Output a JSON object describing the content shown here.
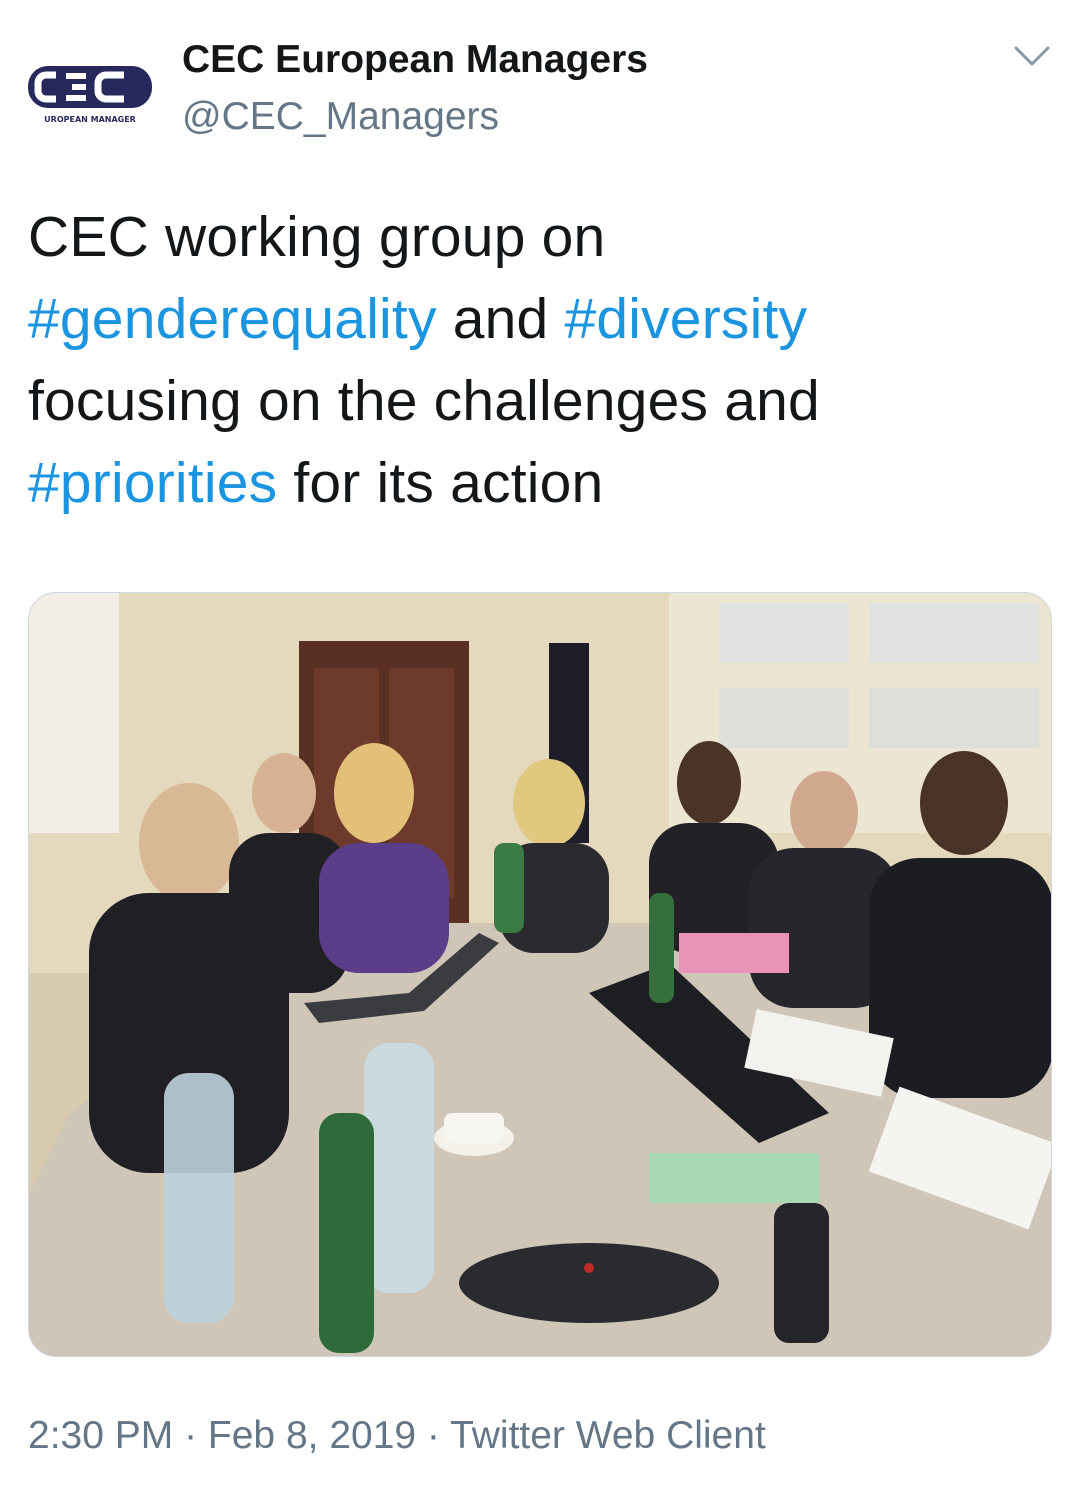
{
  "account": {
    "display_name": "CEC European Managers",
    "handle": "@CEC_Managers",
    "avatar_logo_text": "CEC",
    "avatar_logo_subtext": "UROPEAN MANAGER"
  },
  "tweet": {
    "lines": [
      [
        {
          "text": "CEC working group on",
          "type": "text"
        }
      ],
      [
        {
          "text": "#genderequality",
          "type": "hashtag"
        },
        {
          "text": " and ",
          "type": "text"
        },
        {
          "text": "#diversity",
          "type": "hashtag"
        }
      ],
      [
        {
          "text": "focusing on the challenges and",
          "type": "text"
        }
      ],
      [
        {
          "text": "#priorities",
          "type": "hashtag"
        },
        {
          "text": " for its action",
          "type": "text"
        }
      ]
    ]
  },
  "photo": {
    "icon": "photo"
  },
  "footer": {
    "time": "2:30 PM",
    "separator": " · ",
    "date": "Feb 8, 2019",
    "client": "Twitter Web Client"
  },
  "colors": {
    "hashtag": "#1b95e0",
    "secondary_text": "#657786",
    "primary_text": "#14171a",
    "logo_navy": "#27285c"
  }
}
